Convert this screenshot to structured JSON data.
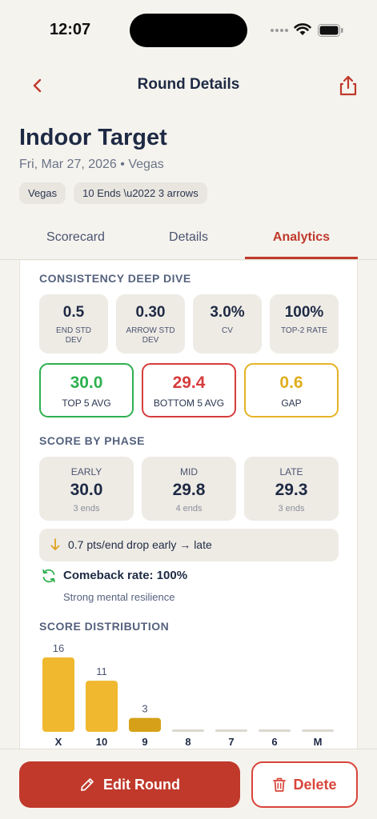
{
  "status": {
    "time": "12:07"
  },
  "nav": {
    "title": "Round Details"
  },
  "round": {
    "title": "Indoor Target",
    "subtitle": "Fri, Mar 27, 2026 • Vegas",
    "tags": [
      "Vegas",
      "10 Ends \\u2022 3 arrows"
    ]
  },
  "tabs": [
    {
      "label": "Scorecard",
      "active": false
    },
    {
      "label": "Details",
      "active": false
    },
    {
      "label": "Analytics",
      "active": true
    }
  ],
  "consistency": {
    "heading": "CONSISTENCY DEEP DIVE",
    "stats": [
      {
        "value": "0.5",
        "label_lines": [
          "END STD",
          "DEV"
        ]
      },
      {
        "value": "0.30",
        "label_lines": [
          "ARROW STD",
          "DEV"
        ]
      },
      {
        "value": "3.0%",
        "label_lines": [
          "CV"
        ]
      },
      {
        "value": "100%",
        "label_lines": [
          "TOP-2 RATE"
        ]
      }
    ],
    "averages": [
      {
        "value": "30.0",
        "label": "TOP 5 AVG"
      },
      {
        "value": "29.4",
        "label": "BOTTOM 5 AVG"
      },
      {
        "value": "0.6",
        "label": "GAP"
      }
    ]
  },
  "phase": {
    "heading": "SCORE BY PHASE",
    "items": [
      {
        "name": "EARLY",
        "value": "30.0",
        "ends": "3 ends"
      },
      {
        "name": "MID",
        "value": "29.8",
        "ends": "4 ends"
      },
      {
        "name": "LATE",
        "value": "29.3",
        "ends": "3 ends"
      }
    ],
    "drop_text": "0.7 pts/end drop early → late",
    "comeback_title": "Comeback rate: 100%",
    "comeback_sub": "Strong mental resilience"
  },
  "distribution": {
    "heading": "SCORE DISTRIBUTION"
  },
  "chart_data": {
    "type": "bar",
    "categories": [
      "X",
      "10",
      "9",
      "8",
      "7",
      "6",
      "M"
    ],
    "values": [
      16,
      11,
      3,
      0,
      0,
      0,
      0
    ],
    "data_labels": [
      "16",
      "11",
      "3",
      "",
      "",
      "",
      ""
    ],
    "colors": [
      "#efb82e",
      "#efb82e",
      "#d6a118",
      "#dcd8d0",
      "#dcd8d0",
      "#dcd8d0",
      "#dcd8d0"
    ]
  },
  "actions": {
    "edit_label": "Edit Round",
    "delete_label": "Delete"
  },
  "colors": {
    "accent": "#c0392b",
    "green": "#2eb04f",
    "red": "#d63c3c",
    "gold": "#e0ad1e",
    "navy": "#1e2a44"
  }
}
